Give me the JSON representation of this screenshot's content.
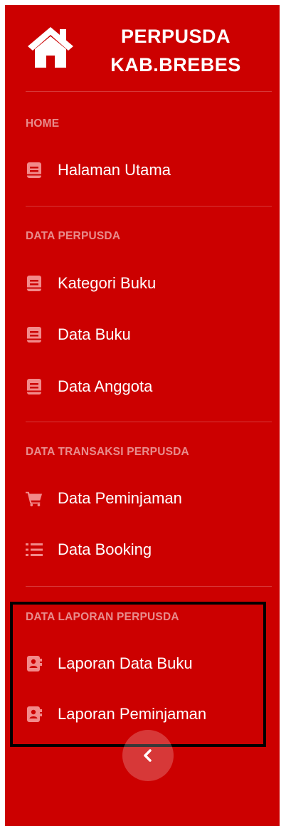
{
  "brand": {
    "line1": "PERPUSDA",
    "line2": "KAB.BREBES"
  },
  "sections": [
    {
      "heading": "HOME",
      "items": [
        {
          "label": "Halaman Utama",
          "icon": "book-icon"
        }
      ]
    },
    {
      "heading": "DATA PERPUSDA",
      "items": [
        {
          "label": "Kategori Buku",
          "icon": "book-icon"
        },
        {
          "label": "Data Buku",
          "icon": "book-icon"
        },
        {
          "label": "Data Anggota",
          "icon": "book-icon"
        }
      ]
    },
    {
      "heading": "DATA TRANSAKSI PERPUSDA",
      "items": [
        {
          "label": "Data Peminjaman",
          "icon": "cart-icon"
        },
        {
          "label": "Data Booking",
          "icon": "list-icon"
        }
      ]
    },
    {
      "heading": "DATA LAPORAN PERPUSDA",
      "items": [
        {
          "label": "Laporan Data Buku",
          "icon": "address-book-icon"
        },
        {
          "label": "Laporan Peminjaman",
          "icon": "address-book-icon"
        }
      ]
    }
  ],
  "colors": {
    "sidebar_bg": "#cc0000",
    "icon_color": "#f28a8a",
    "highlight_border": "#000000"
  },
  "toggle": {
    "icon": "chevron-left-icon"
  }
}
